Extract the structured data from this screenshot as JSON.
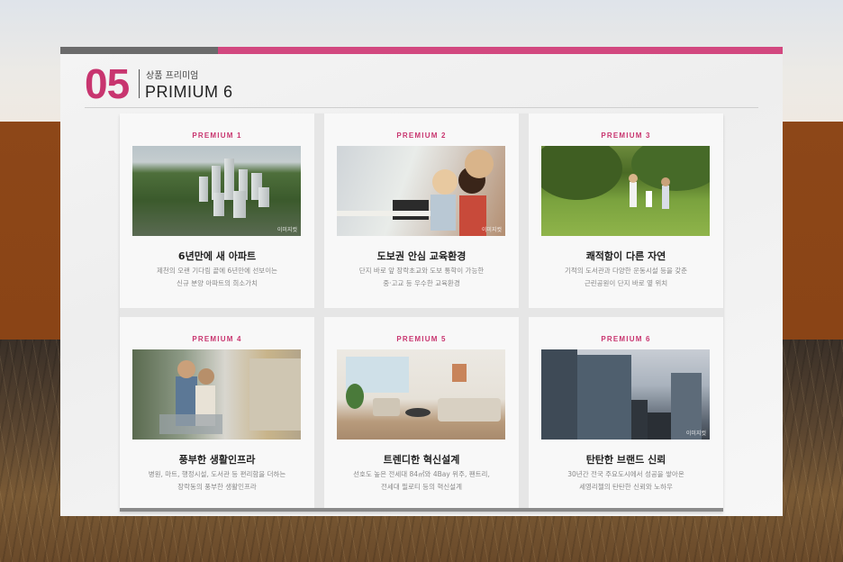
{
  "section": {
    "number": "05",
    "subtitle": "상품 프리미엄",
    "title": "PRIMIUM 6"
  },
  "cards": [
    {
      "tag": "PREMIUM 1",
      "title": "6년만에 새 아파트",
      "desc": [
        "제천의 오랜 기다림 끝에 6년만에 선보이는",
        "신규 분양 아파트의 희소가치"
      ],
      "caption": "이미지컷",
      "image_name": "aerial-apartment-complex"
    },
    {
      "tag": "PREMIUM 2",
      "title": "도보권 안심 교육환경",
      "desc": [
        "단지 바로 앞 장락초교와 도보 통학이 가능한",
        "중·고교 등 우수한 교육환경"
      ],
      "caption": "이미지컷",
      "image_name": "children-studying"
    },
    {
      "tag": "PREMIUM 3",
      "title": "쾌적함이 다른 자연",
      "desc": [
        "기적의 도서관과 다양한 운동시설 등을 갖춘",
        "근린공원이 단지 바로 옆 위치"
      ],
      "caption": "",
      "image_name": "family-in-park"
    },
    {
      "tag": "PREMIUM 4",
      "title": "풍부한 생활인프라",
      "desc": [
        "병원, 마트, 행정시설, 도서관 등 편리함을 더하는",
        "장락동의 풍부한 생활인프라"
      ],
      "caption": "",
      "image_name": "couple-shopping"
    },
    {
      "tag": "PREMIUM 5",
      "title": "트렌디한 혁신설계",
      "desc": [
        "선호도 높은 전세대 84㎡와 4Bay 위주, 팬트리,",
        "전세대 필로티 등의 혁신설계"
      ],
      "caption": "",
      "image_name": "modern-living-room"
    },
    {
      "tag": "PREMIUM 6",
      "title": "탄탄한 브랜드 신뢰",
      "desc": [
        "30년간 전국 주요도시에서 성공을 쌓아온",
        "세영리첼의 탄탄한 신뢰와 노하우"
      ],
      "caption": "이미지컷",
      "image_name": "city-skyline"
    }
  ],
  "colors": {
    "accent": "#c8356f",
    "bar_pink": "#d2487f",
    "bar_gray": "#6b6b6b",
    "band": "#8d4718"
  }
}
